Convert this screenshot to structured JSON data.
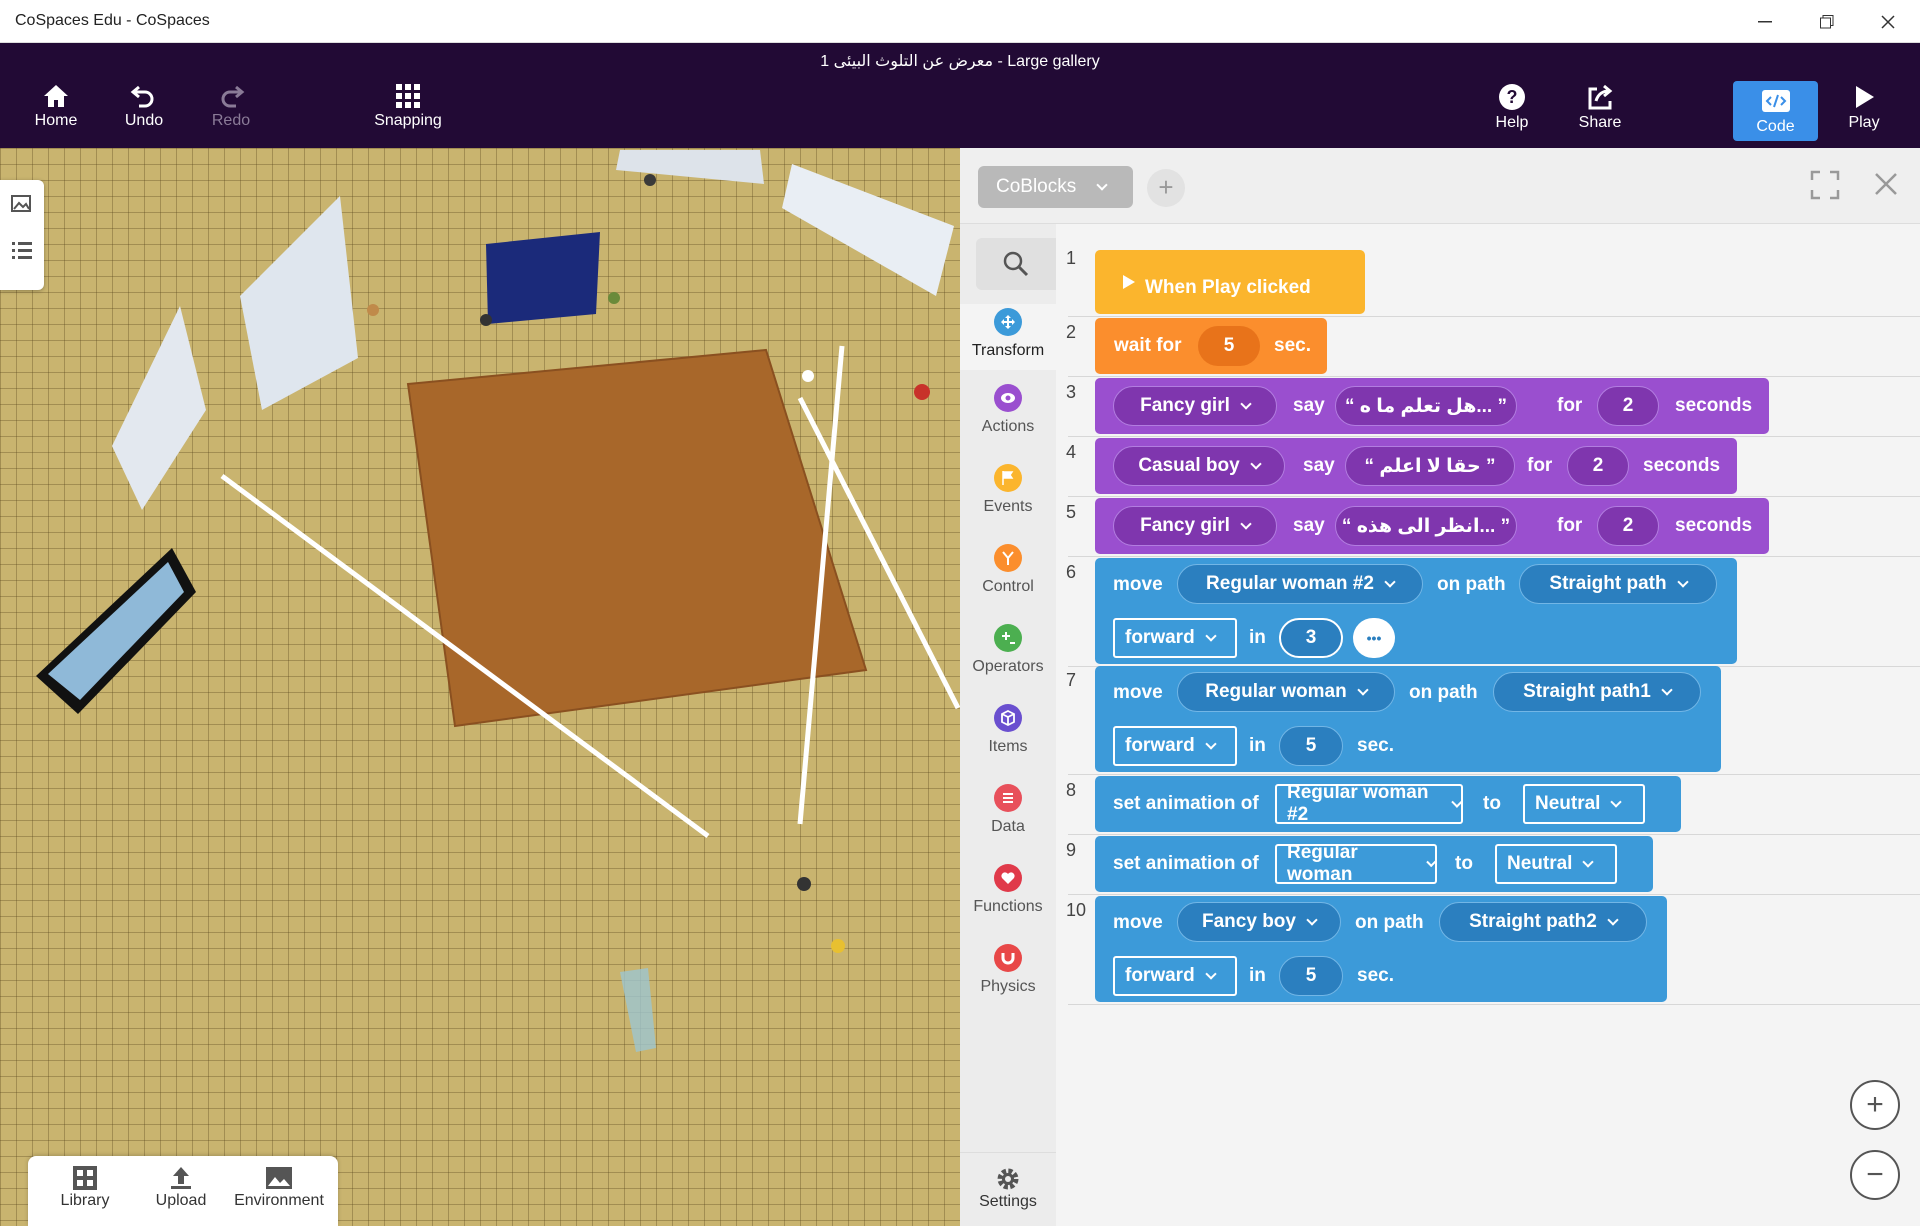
{
  "window": {
    "title": "CoSpaces Edu - CoSpaces"
  },
  "header": {
    "project_title": "1 معرض عن التلوث البيئى - Large gallery"
  },
  "toolbar": {
    "home": "Home",
    "undo": "Undo",
    "redo": "Redo",
    "snapping": "Snapping",
    "help": "Help",
    "share": "Share",
    "code": "Code",
    "play": "Play"
  },
  "bottom_tabs": {
    "library": "Library",
    "upload": "Upload",
    "environment": "Environment"
  },
  "panel": {
    "engine": "CoBlocks",
    "settings": "Settings"
  },
  "categories": [
    {
      "label": "Transform",
      "color": "#3c9ad9",
      "icon": "transform-icon"
    },
    {
      "label": "Actions",
      "color": "#9a4fcf",
      "icon": "eye-icon"
    },
    {
      "label": "Events",
      "color": "#fbb52d",
      "icon": "flag-icon"
    },
    {
      "label": "Control",
      "color": "#fb8e2d",
      "icon": "branch-icon"
    },
    {
      "label": "Operators",
      "color": "#4caf50",
      "icon": "plus-icon"
    },
    {
      "label": "Items",
      "color": "#6a4fcf",
      "icon": "cube-icon"
    },
    {
      "label": "Data",
      "color": "#e8505b",
      "icon": "list-icon"
    },
    {
      "label": "Functions",
      "color": "#e03a4a",
      "icon": "heart-icon"
    },
    {
      "label": "Physics",
      "color": "#e84848",
      "icon": "magnet-icon"
    }
  ],
  "lines": [
    "1",
    "2",
    "3",
    "4",
    "5",
    "6",
    "7",
    "8",
    "9",
    "10"
  ],
  "blocks": {
    "b1": {
      "text": "When Play clicked"
    },
    "b2": {
      "a": "wait for",
      "v": "5",
      "b": "sec."
    },
    "b3": {
      "item": "Fancy girl",
      "say": "say",
      "msg": "“ هل تعلم ما ه... ”",
      "for": "for",
      "v": "2",
      "unit": "seconds"
    },
    "b4": {
      "item": "Casual boy",
      "say": "say",
      "msg": "“ حقا لا اعلم ”",
      "for": "for",
      "v": "2",
      "unit": "seconds"
    },
    "b5": {
      "item": "Fancy girl",
      "say": "say",
      "msg": "“ انظر الى هذه... ”",
      "for": "for",
      "v": "2",
      "unit": "seconds"
    },
    "b6": {
      "move": "move",
      "item": "Regular woman #2",
      "onpath": "on path",
      "path": "Straight path",
      "dir": "forward",
      "in": "in",
      "v": "3",
      "more": "•••"
    },
    "b7": {
      "move": "move",
      "item": "Regular woman",
      "onpath": "on path",
      "path": "Straight path1",
      "dir": "forward",
      "in": "in",
      "v": "5",
      "unit": "sec."
    },
    "b8": {
      "label": "set animation of",
      "item": "Regular woman #2",
      "to": "to",
      "anim": "Neutral"
    },
    "b9": {
      "label": "set animation of",
      "item": "Regular woman",
      "to": "to",
      "anim": "Neutral"
    },
    "b10": {
      "move": "move",
      "item": "Fancy boy",
      "onpath": "on path",
      "path": "Straight path2",
      "dir": "forward",
      "in": "in",
      "v": "5",
      "unit": "sec."
    }
  },
  "zoom": {
    "in": "+",
    "out": "−"
  }
}
